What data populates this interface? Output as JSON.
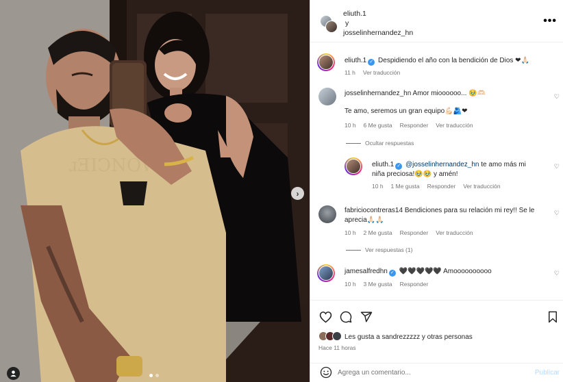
{
  "header": {
    "author1": "eliuth.1",
    "conjunction": "y",
    "author2": "josselinhernandez_hn"
  },
  "caption": {
    "user": "eliuth.1",
    "text": "Despidiendo el año con la bendición de Dios ❤🙏🏻",
    "time": "11 h",
    "translate": "Ver traducción"
  },
  "comments": [
    {
      "user": "josselinhernandez_hn",
      "text_line1": "Amor mioooooo... 🥹🫶🏻",
      "text_line2": "Te amo, seremos un gran equipo💪🏻🫂❤",
      "time": "10 h",
      "likes": "6 Me gusta",
      "reply": "Responder",
      "translate": "Ver traducción",
      "toggle": "Ocultar respuestas"
    },
    {
      "user": "eliuth.1",
      "mention": "@josselinhernandez_hn",
      "text_line1": " te amo más mi",
      "text_line2": "niña preciosa!🥹🥹 y amén!",
      "time": "10 h",
      "likes": "1 Me gusta",
      "reply": "Responder",
      "translate": "Ver traducción"
    },
    {
      "user": "fabriciocontreras14",
      "text_line1": "Bendiciones para su relación mi rey!! Se le",
      "text_line2": "aprecia🙏🏻🙏🏻",
      "time": "10 h",
      "likes": "2 Me gusta",
      "reply": "Responder",
      "translate": "Ver traducción",
      "toggle": "Ver respuestas (1)"
    },
    {
      "user": "jamesalfredhn",
      "text": "🖤🖤🖤🖤🖤 Amoooooooooo",
      "time": "10 h",
      "likes": "3 Me gusta",
      "reply": "Responder"
    }
  ],
  "likes_summary": {
    "prefix": "Les gusta a",
    "user": "sandrezzzzz",
    "suffix": "y otras personas"
  },
  "timestamp": "Hace 11 horas",
  "add_comment": {
    "placeholder": "Agrega un comentario...",
    "publish": "Publicar"
  },
  "icons": {
    "like": "heart-outline-icon",
    "comment": "comment-bubble-icon",
    "share": "paper-plane-icon",
    "save": "bookmark-icon",
    "more": "more-horizontal-icon",
    "emoji": "smiley-icon",
    "next": "chevron-right-icon",
    "tag": "user-tag-icon"
  },
  "carousel": {
    "slide_count": 2,
    "active_slide": 1
  },
  "colors": {
    "link": "#00376b",
    "verified": "#3897f0",
    "muted": "#737373",
    "publish_disabled": "#b3dbff"
  }
}
